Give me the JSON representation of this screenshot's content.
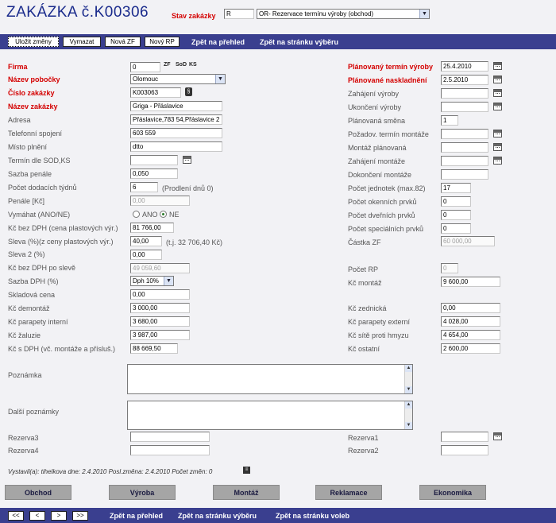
{
  "header": {
    "title": "ZAKÁZKA č.K00306",
    "status_label": "Stav zakázky",
    "status_code": "R",
    "status_value": "OR- Rezervace termínu výroby (obchod)"
  },
  "toolbar": {
    "save": "Uložit změny",
    "delete": "Vymazat",
    "new_zf": "Nová ZF",
    "new_rp": "Nový RP",
    "link_overview": "Zpět na přehled",
    "link_selection": "Zpět na stránku výběru"
  },
  "left": {
    "firma": {
      "label": "Firma",
      "value": "0"
    },
    "icons": {
      "zf": "ZF",
      "sod": "SoD",
      "ks": "KS"
    },
    "pobocka": {
      "label": "Název pobočky",
      "value": "Olomouc"
    },
    "cislo": {
      "label": "Číslo zakázky",
      "value": "K003063"
    },
    "nazev": {
      "label": "Název zakázky",
      "value": "Griga  - Přáslavice"
    },
    "adresa": {
      "label": "Adresa",
      "value": "Přáslavice,783 54,Přáslavice 2"
    },
    "telefon": {
      "label": "Telefonní spojení",
      "value": "603 559"
    },
    "misto": {
      "label": "Místo plnění",
      "value": "dtto"
    },
    "termin_sod": {
      "label": "Termín dle SOD,KS",
      "value": ""
    },
    "sazba_penale": {
      "label": "Sazba penále",
      "value": "0,050"
    },
    "pocet_tydnu": {
      "label": "Počet dodacích týdnů",
      "value": "6",
      "note": "(Prodlení dnů 0)"
    },
    "penale": {
      "label": "Penále [Kč]",
      "value": "0,00"
    },
    "vymahat": {
      "label": "Vymáhat (ANO/NE)",
      "ano": "ANO",
      "ne": "NE",
      "selected": "NE"
    },
    "kc_bez_dph": {
      "label": "Kč bez DPH (cena plastových výr.)",
      "value": "81 766,00"
    },
    "sleva": {
      "label": "Sleva (%)(z ceny plastových výr.)",
      "value": "40,00",
      "note": "(t.j. 32 706,40 Kč)"
    },
    "sleva2": {
      "label": "Sleva 2 (%)",
      "value": "0,00"
    },
    "kc_po_sleve": {
      "label": "Kč bez DPH po slevě",
      "value": "49 059,60"
    },
    "sazba_dph": {
      "label": "Sazba DPH (%)",
      "value": "Dph 10%"
    },
    "skladova": {
      "label": "Skladová cena",
      "value": "0,00"
    },
    "demontaz": {
      "label": "Kč demontáž",
      "value": "3 000,00"
    },
    "parapety_int": {
      "label": "Kč parapety interní",
      "value": "3 680,00"
    },
    "zaluzie": {
      "label": "Kč žaluzie",
      "value": "3 987,00"
    },
    "kc_s_dph": {
      "label": "Kč s DPH (vč. montáže a přísluš.)",
      "value": "88 669,50"
    }
  },
  "right": {
    "plan_vyroby": {
      "label": "Plánovaný termín výroby",
      "value": "25.4.2010"
    },
    "plan_nasklad": {
      "label": "Plánované naskladnění",
      "value": "2.5.2010"
    },
    "zahajeni_vyroby": {
      "label": "Zahájení výroby",
      "value": ""
    },
    "ukonceni_vyroby": {
      "label": "Ukončení výroby",
      "value": ""
    },
    "smena": {
      "label": "Plánovaná směna",
      "value": "1"
    },
    "pozad_montaz": {
      "label": "Požadov. termín montáže",
      "value": ""
    },
    "montaz_plan": {
      "label": "Montáž plánovaná",
      "value": ""
    },
    "zahajeni_montaze": {
      "label": "Zahájení montáže",
      "value": ""
    },
    "dokonceni_montaze": {
      "label": "Dokončení montáže",
      "value": ""
    },
    "pocet_jednotek": {
      "label": "Počet jednotek (max.82)",
      "value": "17"
    },
    "okenni": {
      "label": "Počet okenních prvků",
      "value": "0"
    },
    "dverni": {
      "label": "Počet dveřních prvků",
      "value": "0"
    },
    "specialni": {
      "label": "Počet speciálních prvků",
      "value": "0"
    },
    "castka_zf": {
      "label": "Částka ZF",
      "value": "60 000,00"
    },
    "pocet_rp": {
      "label": "Počet RP",
      "value": "0"
    },
    "kc_montaz": {
      "label": "Kč montáž",
      "value": "9 600,00"
    },
    "zednicka": {
      "label": "Kč zednická",
      "value": "0,00"
    },
    "parapety_ext": {
      "label": "Kč parapety externí",
      "value": "4 028,00"
    },
    "site": {
      "label": "Kč sítě proti hmyzu",
      "value": "4 654,00"
    },
    "ostatni": {
      "label": "Kč ostatní",
      "value": "2 600,00"
    }
  },
  "notes": {
    "poznamka": "Poznámka",
    "dalsi": "Další poznámky",
    "rezerva3": "Rezerva3",
    "rezerva4": "Rezerva4",
    "rezerva1": "Rezerva1",
    "rezerva2": "Rezerva2"
  },
  "footer_info": {
    "text": "Vystavil(a): tihelkova  dne: 2.4.2010  Posl.změna: 2.4.2010     Počet změn: 0"
  },
  "tabs": [
    "Obchod",
    "Výroba",
    "Montáž",
    "Reklamace",
    "Ekonomika"
  ],
  "bottom_nav": {
    "first": "<<",
    "prev": "<",
    "next": ">",
    "last": ">>",
    "link_overview": "Zpět na přehled",
    "link_selection": "Zpět na stránku výběru",
    "link_voleb": "Zpět na stránku voleb"
  }
}
